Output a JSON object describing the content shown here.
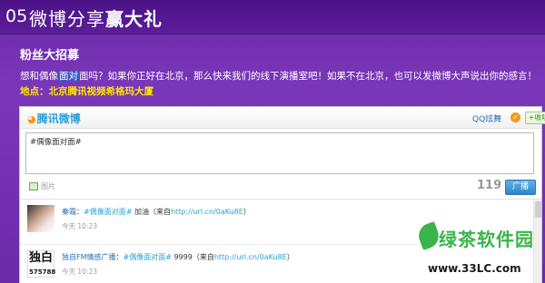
{
  "header": {
    "number": "05",
    "title_regular": "微博分享",
    "title_bold": "赢大礼"
  },
  "section": {
    "title": "粉丝大招募",
    "intro_before": "想和偶像",
    "intro_highlight": "面对",
    "intro_after": "面吗？如果你正好在北京，那么快来我们的线下演播室吧！如果不在北京，也可以发微博大声说出你的感言！",
    "location": "地点：北京腾讯视频希格玛大厦"
  },
  "weibo": {
    "logo": "腾讯微博",
    "user": "QQ炫舞",
    "follow_label": "+收听",
    "textarea_value": "#偶像面对面#",
    "image_label": "图片",
    "char_count": "119",
    "post_label": "广播"
  },
  "feed": [
    {
      "user": "秦霜",
      "tag": "#偶像面对面#",
      "text": " 加油（来自",
      "link": "http://url.cn/0aKu8E",
      "end": "）",
      "time": "今天 10:23"
    },
    {
      "user": "独自FM情感广播",
      "tag": "#偶像面对面#",
      "text": " 9999（来自",
      "link": "http://url.cn/0aKu8E",
      "end": "）",
      "time": "今天 10:23",
      "avatar_text": "独白",
      "avatar_num": "575788"
    }
  ],
  "watermark": {
    "name": "绿茶软件园",
    "url": "www.33LC.com"
  },
  "colors": {
    "background": "#6a2aa8",
    "header": "#4a1286",
    "location_text": "#ffe800",
    "weibo_blue": "#2b9fd8",
    "watermark_green": "#39b54a"
  }
}
